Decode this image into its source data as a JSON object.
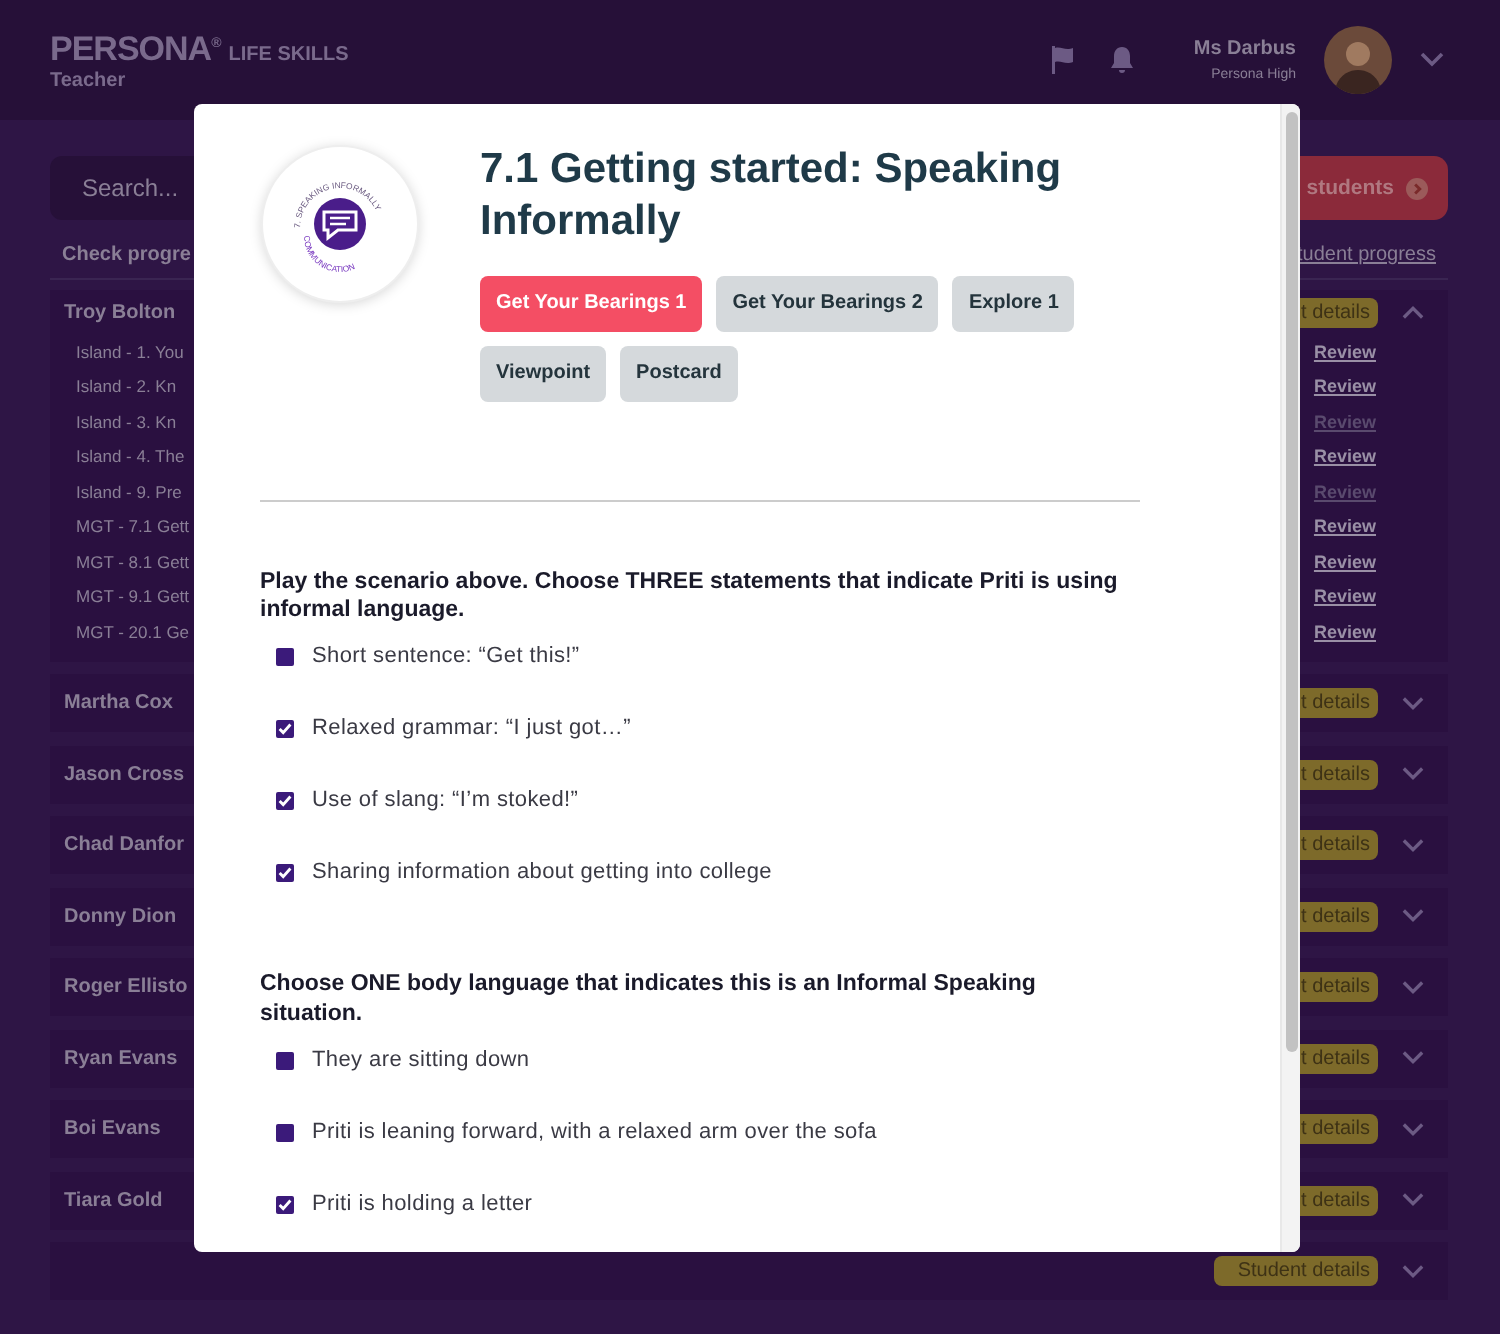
{
  "header": {
    "brand": "PERSONA",
    "brand_mark": "®",
    "product": "LIFE SKILLS",
    "role": "Teacher",
    "user_name": "Ms Darbus",
    "school": "Persona High"
  },
  "toolbar": {
    "search": {
      "placeholder": "Search..."
    },
    "button": "students",
    "check_label": "Check progre",
    "progress_link": "tudent progress"
  },
  "students": [
    {
      "name": "Troy Bolton",
      "details": "t details",
      "expanded": true,
      "activities": [
        {
          "label": "Island - 1. You",
          "review": "Review",
          "disabled": false
        },
        {
          "label": "Island - 2. Kn",
          "review": "Review",
          "disabled": false
        },
        {
          "label": "Island - 3. Kn",
          "review": "Review",
          "disabled": true
        },
        {
          "label": "Island - 4. The",
          "review": "Review",
          "disabled": false
        },
        {
          "label": "Island - 9. Pre",
          "review": "Review",
          "disabled": true
        },
        {
          "label": "MGT - 7.1 Gett",
          "review": "Review",
          "disabled": false
        },
        {
          "label": "MGT - 8.1 Gett",
          "review": "Review",
          "disabled": false
        },
        {
          "label": "MGT - 9.1 Gett",
          "review": "Review",
          "disabled": false
        },
        {
          "label": "MGT - 20.1 Ge",
          "review": "Review",
          "disabled": false
        }
      ]
    },
    {
      "name": "Martha Cox",
      "details": "t details",
      "expanded": false
    },
    {
      "name": "Jason Cross",
      "details": "t details",
      "expanded": false
    },
    {
      "name": "Chad Danfor",
      "details": "t details",
      "expanded": false
    },
    {
      "name": "Donny Dion",
      "details": "t details",
      "expanded": false
    },
    {
      "name": "Roger Ellisto",
      "details": "t details",
      "expanded": false
    },
    {
      "name": "Ryan Evans",
      "details": "t details",
      "expanded": false
    },
    {
      "name": "Boi Evans",
      "details": "t details",
      "expanded": false
    },
    {
      "name": "Tiara Gold",
      "details": "t details",
      "expanded": false
    },
    {
      "details": "Student details",
      "expanded": false
    }
  ],
  "modal": {
    "badge_top": "7. SPEAKING INFORMALLY",
    "badge_bottom": "COMMUNICATION",
    "title": "7.1 Getting started: Speaking Informally",
    "tabs": [
      {
        "label": "Get Your Bearings 1",
        "selected": true
      },
      {
        "label": "Get Your Bearings 2",
        "selected": false
      },
      {
        "label": "Explore 1",
        "selected": false
      },
      {
        "label": "Viewpoint",
        "selected": false
      },
      {
        "label": "Postcard",
        "selected": false
      }
    ],
    "questions": [
      {
        "prompt": "Play the scenario above. Choose THREE statements that indicate Priti is using informal language.",
        "options": [
          {
            "label": "Short sentence: “Get this!”",
            "checked": false
          },
          {
            "label": "Relaxed grammar: “I just got…”",
            "checked": true
          },
          {
            "label": "Use of slang: “I’m stoked!”",
            "checked": true
          },
          {
            "label": "Sharing information about getting into college",
            "checked": true
          }
        ]
      },
      {
        "prompt": "Choose ONE body language that indicates this is an Informal Speaking situation.",
        "options": [
          {
            "label": "They are sitting down",
            "checked": false
          },
          {
            "label": "Priti is leaning forward, with a relaxed arm over the sofa",
            "checked": false
          },
          {
            "label": "Priti is holding a letter",
            "checked": true
          }
        ]
      }
    ]
  }
}
